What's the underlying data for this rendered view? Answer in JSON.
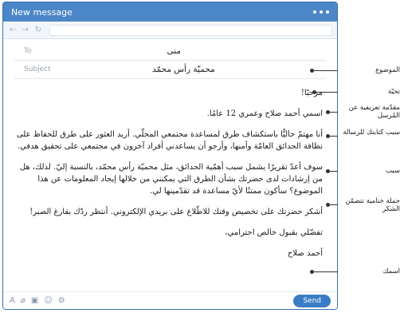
{
  "window": {
    "title": "New message"
  },
  "fields": {
    "to_label": "To",
    "to_value": "منى",
    "subject_label": "Subject",
    "subject_value": "محميّة رأس محمّد"
  },
  "body": {
    "greeting": "مرحبًا!",
    "intro": "اسمي أحمد صلاح وعمري 12 عامًا.",
    "reason": "أنا مهتمّ حاليًّا باستكشاف طرق لمساعدة مجتمعي المحلّي. أريد العثور على طرق للحفاظ على نظافة الحدائق العامّة وأمنها، وأرجو أن يساعدني أفراد آخرون في مجتمعي على تحقيق هدفي.",
    "request": "سوف أعدّ تقريرًا يشمل سبب أهمّية الحدائق، مثل محميّة رأس محمّد، بالنسبة إليّ. لذلك، هل من إرشادات لدى حضرتك بشأن الطرق التي يمكنني من خلالها إيجاد المعلومات عن هذا الموضوع؟ سأكون ممتنًا لأيّ مساعدة قد تقدّمينها لي.",
    "thanks": "أشكر حضرتك على تخصيص وقتك للاطّلاع على بريدي الإلكتروني. أنتظر ردّك بفارغ الصبر!",
    "closing": "تفضّلي بقبول خالص احترامي،",
    "signature": "أحمد صلاح"
  },
  "toolbar": {
    "send_label": "Send"
  },
  "annotations": {
    "subject": "الموضوع",
    "greeting": "تحيّة",
    "intro": "مقدّمة تعريفية عن المُرسل",
    "reason": "سبب كتابتك للرسالة",
    "request": "سبب",
    "thanks": "جملة ختامية تتضمّن الشكر",
    "name": "اسمك"
  }
}
